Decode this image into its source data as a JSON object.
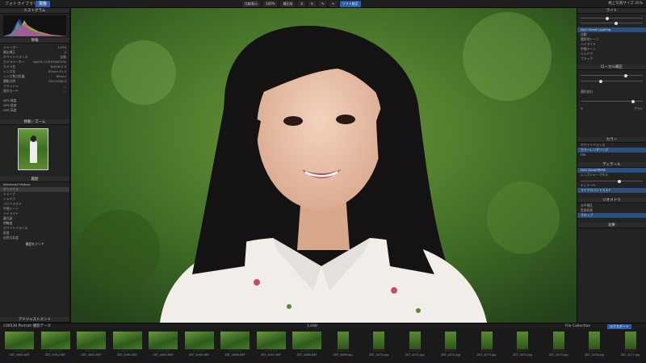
{
  "top": {
    "tab_library": "フォトライブラリ",
    "tab_develop": "現像",
    "center_buttons": [
      "比較表示",
      "100%",
      "補正前",
      "ソフト校正"
    ],
    "right_label": "極上写真サイズ 35%"
  },
  "left": {
    "histogram_header": "ヒストグラム",
    "info_header": "情報",
    "nav_header": "移動／ズーム",
    "history_header": "履歴",
    "exif": [
      {
        "k": "シャッター",
        "v": "1/250"
      },
      {
        "k": "露出補正",
        "v": "0"
      },
      {
        "k": "ホワイトバランス",
        "v": "自動"
      },
      {
        "k": "カメラメーカー",
        "v": "NIKON CORPORATION"
      },
      {
        "k": "カメラ名",
        "v": "NIKON Z 8"
      },
      {
        "k": "レンズ名",
        "v": "85mm f/1.4"
      },
      {
        "k": "レンズ焦点距離",
        "v": "85mm"
      },
      {
        "k": "撮影日時",
        "v": "2023/06/03"
      },
      {
        "k": "フラッシュ",
        "v": "—"
      },
      {
        "k": "測光モード",
        "v": "—"
      }
    ],
    "gps": [
      "GPS 緯度",
      "GPS 経度",
      "GPS 高度"
    ],
    "history_title": "Advanced History",
    "history_items": [
      "オリジナル",
      "シャープ",
      "シャドウ",
      "コントラスト",
      "中間トーン",
      "ハイライト",
      "露光量",
      "明瞭度",
      "ホワイトバランス",
      "彩度",
      "自然な彩度"
    ],
    "history_button": "履歴をクリア",
    "footer_header": "アドジャストメント"
  },
  "right": {
    "light_header": "ライト",
    "rows1": [
      "DxO Smart Lighting",
      "自動",
      "選択的トーン",
      "ハイライト",
      "中間トーン",
      "シャドウ",
      "ブラック"
    ],
    "local_header": "ローカル補正",
    "color_header": "カラー",
    "color_rows": [
      "ホワイトバランス",
      "カラーレンダリング",
      "HSL"
    ],
    "detail_header": "ディテール",
    "detail_rows": [
      "DxO DeepPRIME",
      "レンズシャープネス",
      "ディテール",
      "マイクロコントラスト"
    ],
    "geometry_header": "ジオメトリ",
    "geometry_rows": [
      "水平補正",
      "歪曲収差",
      "クロップ"
    ],
    "effects_header": "効果",
    "selection_header": "選択部分",
    "brush_label": "ブラシ"
  },
  "filmstrip": {
    "folder": "230530 Portrait 撮影データ",
    "count_label": "1,048",
    "right_label": "File Collection",
    "export_button": "エクスポート",
    "thumbs": [
      {
        "name": "Z8T_4060.NEF",
        "portrait": false
      },
      {
        "name": "Z8T_4061.NEF",
        "portrait": false
      },
      {
        "name": "Z8T_4062.NEF",
        "portrait": false
      },
      {
        "name": "Z8T_4063.NEF",
        "portrait": false
      },
      {
        "name": "Z8T_4064.NEF",
        "portrait": false
      },
      {
        "name": "Z8T_4065.NEF",
        "portrait": false
      },
      {
        "name": "Z8T_4066.NEF",
        "portrait": false
      },
      {
        "name": "Z8T_4067.NEF",
        "portrait": false
      },
      {
        "name": "Z8T_4068.NEF",
        "portrait": false
      },
      {
        "name": "Z8T_4069.jpg",
        "portrait": true
      },
      {
        "name": "Z8T_4070.jpg",
        "portrait": true
      },
      {
        "name": "Z8T_4071.jpg",
        "portrait": true
      },
      {
        "name": "Z8T_4072.jpg",
        "portrait": true
      },
      {
        "name": "Z8T_4073.jpg",
        "portrait": true
      },
      {
        "name": "Z8T_4074.jpg",
        "portrait": true
      },
      {
        "name": "Z8T_4075.jpg",
        "portrait": true
      },
      {
        "name": "Z8T_4076.jpg",
        "portrait": true
      },
      {
        "name": "Z8T_4077.jpg",
        "portrait": true
      }
    ]
  },
  "colors": {
    "accent": "#2f5fa8",
    "panel": "#232323"
  }
}
